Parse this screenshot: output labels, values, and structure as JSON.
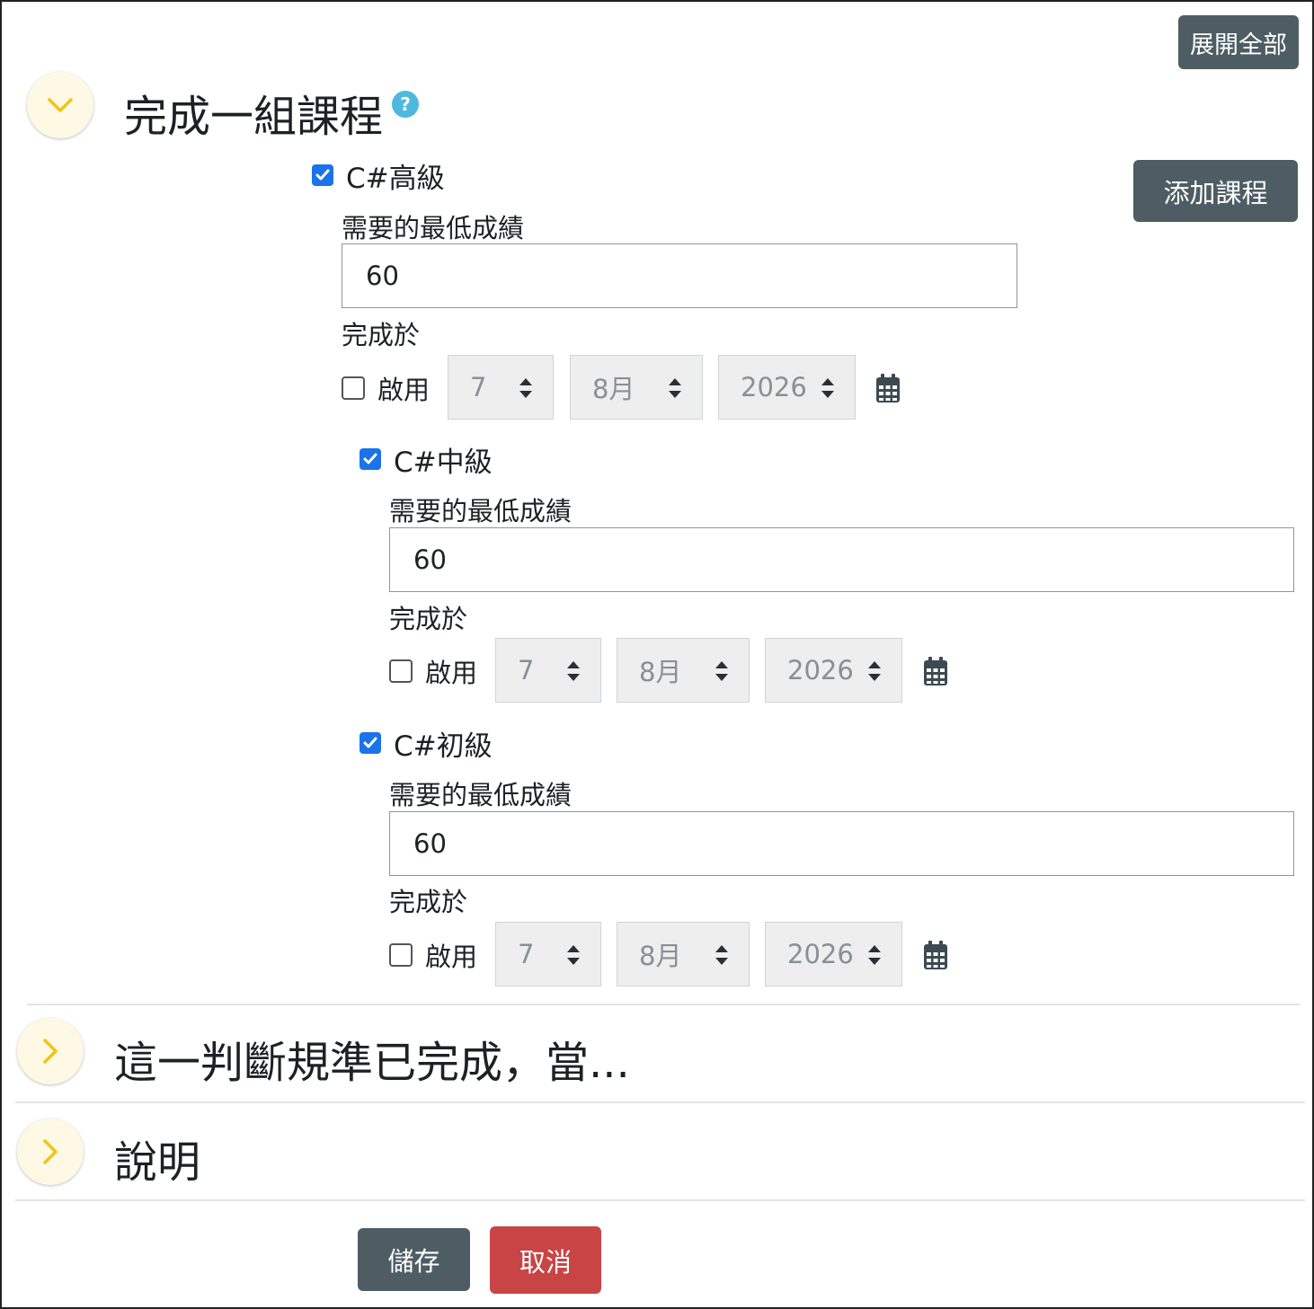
{
  "toolbar": {
    "expand_all": "展開全部",
    "add_course": "添加課程"
  },
  "sections": [
    {
      "title": "完成一組課程",
      "expanded": true
    },
    {
      "title": "這一判斷規準已完成，當..."
    },
    {
      "title": "說明"
    }
  ],
  "courses": [
    {
      "name": "C#高級",
      "checked": true,
      "grade_label": "需要的最低成績",
      "grade": "60",
      "completed_label": "完成於",
      "enable_label": "啟用",
      "day": "7",
      "month": "8月",
      "year": "2026"
    },
    {
      "name": "C#中級",
      "checked": true,
      "grade_label": "需要的最低成績",
      "grade": "60",
      "completed_label": "完成於",
      "enable_label": "啟用",
      "day": "7",
      "month": "8月",
      "year": "2026"
    },
    {
      "name": "C#初級",
      "checked": true,
      "grade_label": "需要的最低成績",
      "grade": "60",
      "completed_label": "完成於",
      "enable_label": "啟用",
      "day": "7",
      "month": "8月",
      "year": "2026"
    }
  ],
  "actions": {
    "save": "儲存",
    "cancel": "取消"
  },
  "colors": {
    "accent": "#1a73e8",
    "button_dark": "#4e5d64",
    "button_danger": "#c94444",
    "toggle_bg": "#fef9e4",
    "chevron": "#f0c419",
    "help": "#4fb8dd"
  },
  "icons": {
    "help": "question-circle-icon",
    "calendar": "calendar-icon",
    "chevron_down": "chevron-down-icon",
    "chevron_right": "chevron-right-icon"
  }
}
